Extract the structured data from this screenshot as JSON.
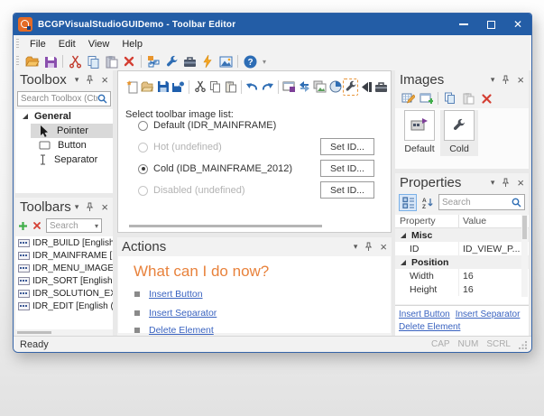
{
  "window": {
    "title": "BCGPVisualStudioGUIDemo - Toolbar Editor"
  },
  "menu": {
    "items": [
      "File",
      "Edit",
      "View",
      "Help"
    ]
  },
  "main_toolbar": {
    "icons": [
      "open",
      "save",
      "cut",
      "copy",
      "paste",
      "delete",
      "customize",
      "wrench",
      "toolbox",
      "lightning",
      "image",
      "help",
      "overflow"
    ]
  },
  "toolbox": {
    "title": "Toolbox",
    "search_placeholder": "Search Toolbox (Ctrl...",
    "group": "General",
    "items": [
      "Pointer",
      "Button",
      "Separator"
    ]
  },
  "toolbars_panel": {
    "title": "Toolbars",
    "toolbar_icons": [
      "add",
      "delete"
    ],
    "search_placeholder": "Search",
    "items": [
      "IDR_BUILD [English (Un",
      "IDR_MAINFRAME [Eng",
      "IDR_MENU_IMAGES [E",
      "IDR_SORT [English (Un",
      "IDR_SOLUTION_EXPLO",
      "IDR_EDIT [English (Unit"
    ]
  },
  "editor": {
    "toolbar_icons": [
      "new",
      "open",
      "save",
      "save-all",
      "cut",
      "copy",
      "paste",
      "undo",
      "redo",
      "window-id",
      "swap-arrows",
      "image-list",
      "pie",
      "wrench",
      "capture",
      "toolbox"
    ],
    "select_label": "Select toolbar image list:",
    "options": [
      {
        "label": "Default (IDR_MAINFRAME)",
        "state": "enabled"
      },
      {
        "label": "Hot (undefined)",
        "state": "disabled"
      },
      {
        "label": "Cold (IDB_MAINFRAME_2012)",
        "state": "selected"
      },
      {
        "label": "Disabled (undefined)",
        "state": "disabled"
      }
    ],
    "set_id_label": "Set ID..."
  },
  "actions": {
    "title": "Actions",
    "heading": "What can I do now?",
    "links": [
      "Insert Button",
      "Insert Separator",
      "Delete Element"
    ]
  },
  "images": {
    "title": "Images",
    "toolbar_icons": [
      "edit-image",
      "export-image",
      "copy",
      "paste",
      "delete"
    ],
    "tiles": [
      {
        "label": "Default",
        "selected": false
      },
      {
        "label": "Cold",
        "selected": true
      }
    ]
  },
  "properties": {
    "title": "Properties",
    "toolbar_icons": [
      "categorized",
      "sort-az"
    ],
    "search_placeholder": "Search",
    "columns": [
      "Property",
      "Value"
    ],
    "rows": [
      {
        "type": "group",
        "name": "Misc"
      },
      {
        "type": "item",
        "property": "ID",
        "value": "ID_VIEW_P..."
      },
      {
        "type": "group",
        "name": "Position"
      },
      {
        "type": "item",
        "property": "Width",
        "value": "16"
      },
      {
        "type": "item",
        "property": "Height",
        "value": "16"
      }
    ],
    "links": [
      "Insert Button",
      "Insert Separator",
      "Delete Element"
    ]
  },
  "status": {
    "ready": "Ready",
    "indicators": [
      "CAP",
      "NUM",
      "SCRL"
    ]
  },
  "colors": {
    "titlebar": "#235da6",
    "accent_orange": "#e8823c",
    "link": "#3a63c0"
  }
}
